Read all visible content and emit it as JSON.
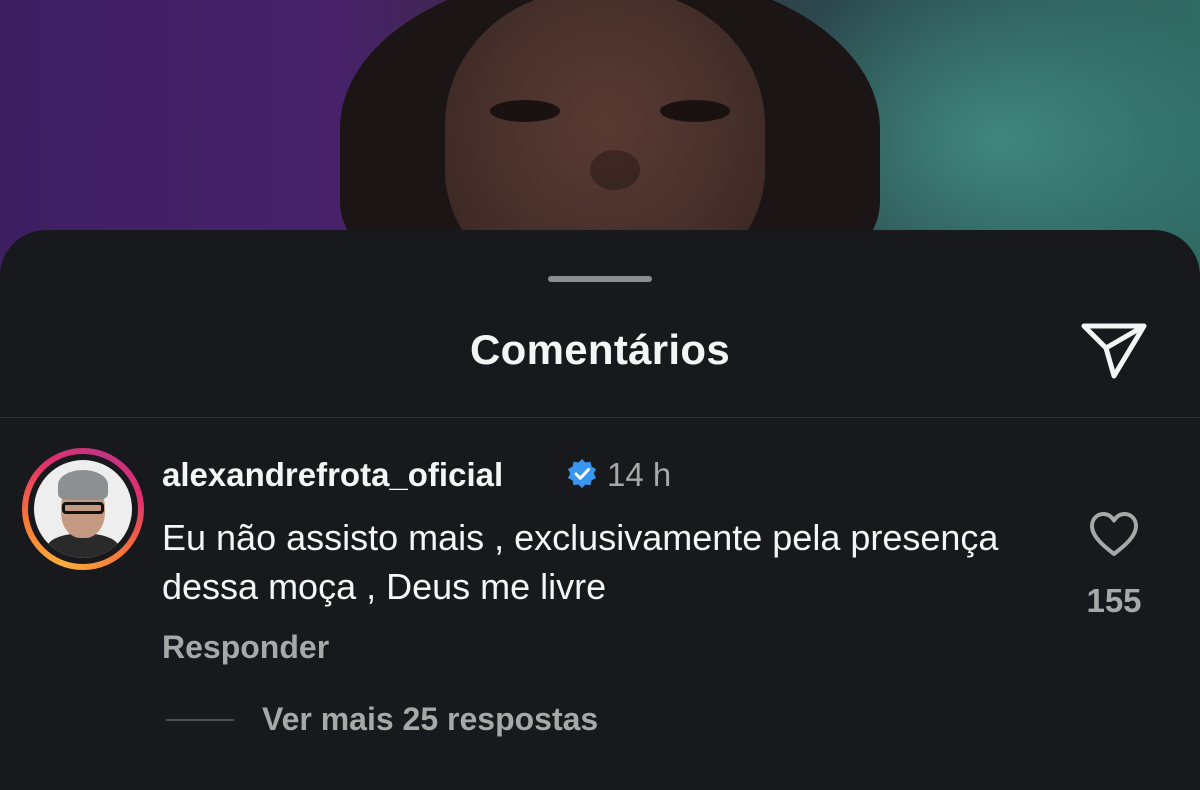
{
  "sheet": {
    "title": "Comentários",
    "share_icon": "send-paper-plane-icon"
  },
  "comment": {
    "username": "alexandrefrota_oficial",
    "verified": true,
    "time": "14 h",
    "text": "Eu não assisto mais , exclusivamente pela presença dessa moça , Deus me livre",
    "reply_label": "Responder",
    "likes": "155",
    "more_replies": "Ver mais 25 respostas"
  },
  "colors": {
    "sheet_bg": "#17191c",
    "primary_text": "#f5f5f5",
    "secondary_text": "#a8a8a8",
    "verified_blue": "#3797f0"
  }
}
